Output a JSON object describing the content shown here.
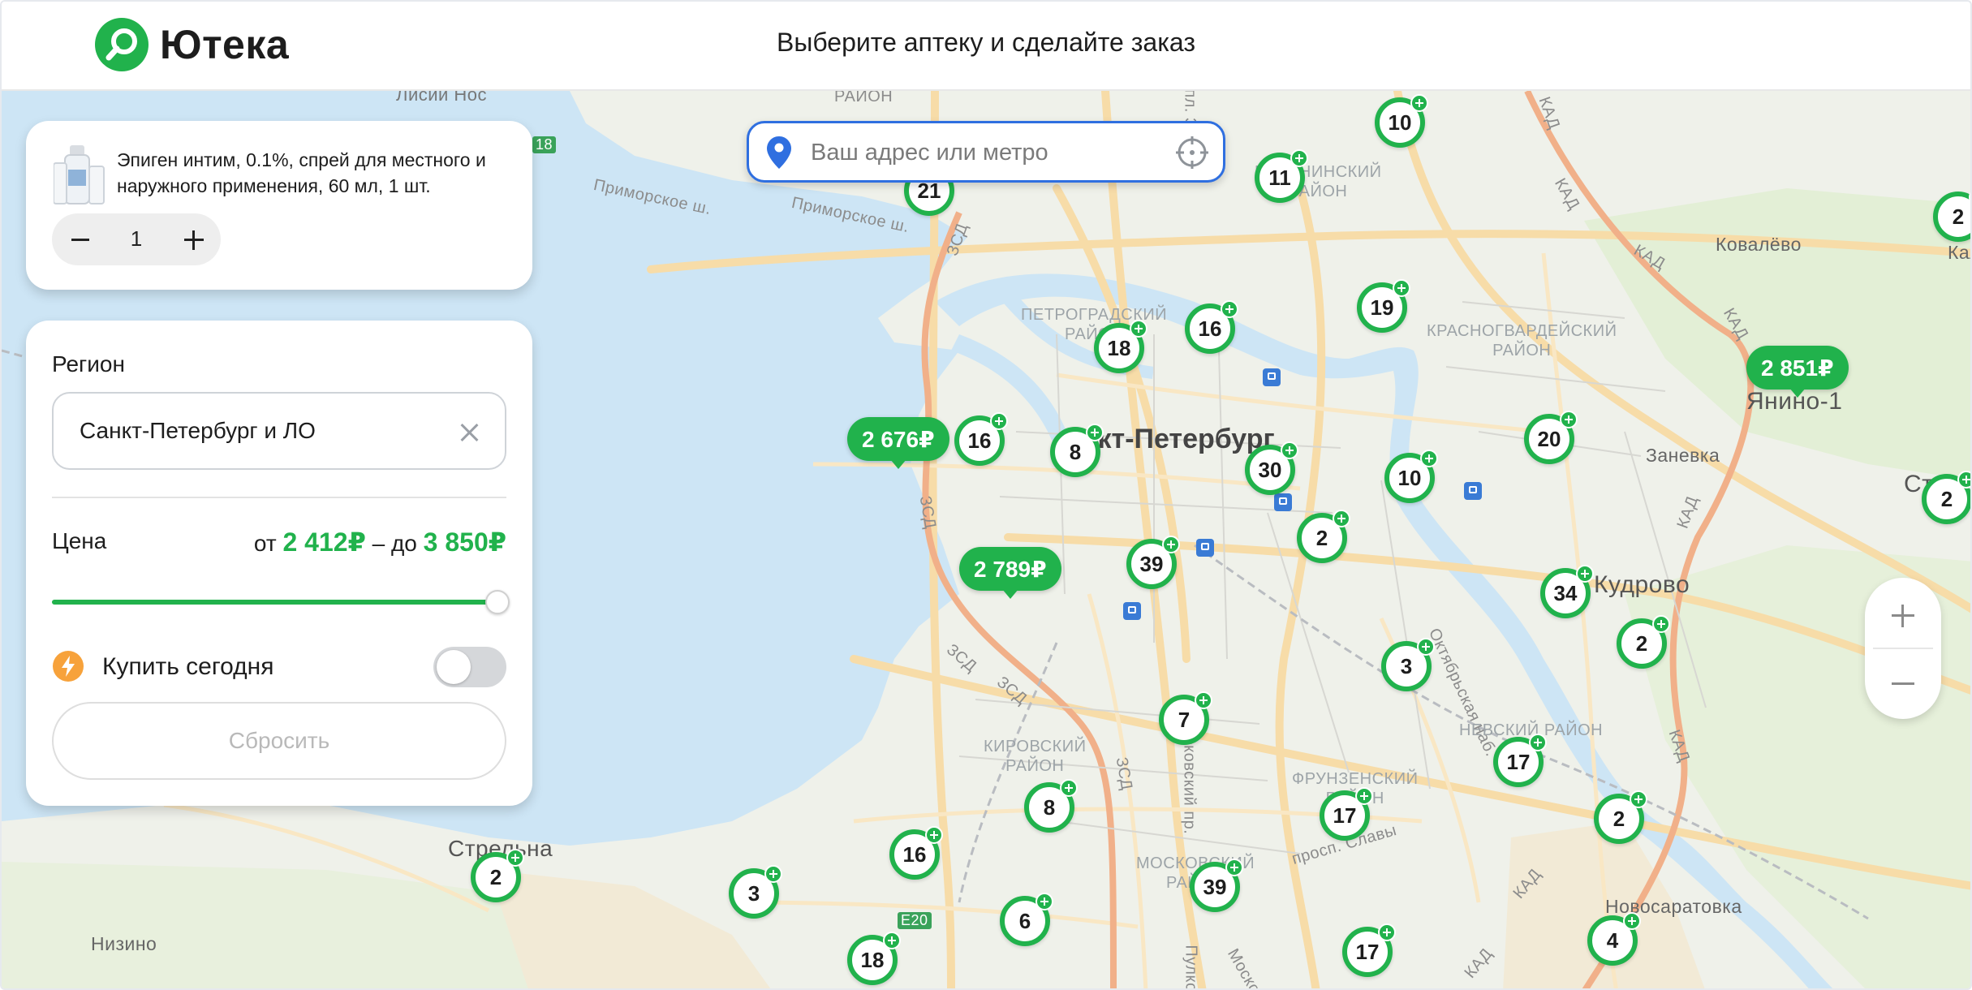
{
  "header": {
    "logo_text": "Ютека",
    "title": "Выберите аптеку и сделайте заказ"
  },
  "search": {
    "placeholder": "Ваш адрес или метро",
    "value": ""
  },
  "product": {
    "name": "Эпиген интим, 0.1%, спрей для местного и наружного применения, 60 мл, 1 шт.",
    "quantity": "1"
  },
  "filters": {
    "region_label": "Регион",
    "region_value": "Санкт-Петербург и ЛО",
    "price_label": "Цена",
    "price_from_prefix": "от",
    "price_from": "2 412₽",
    "price_separator": "– до",
    "price_to": "3 850₽",
    "price_slider_fraction": 0.98,
    "buy_today_label": "Купить сегодня",
    "buy_today_enabled": false,
    "reset_label": "Сбросить"
  },
  "colors": {
    "brand_green": "#21b24c",
    "search_border": "#2f6fe0",
    "bolt_orange": "#f7a23b"
  },
  "map": {
    "markers": [
      "21",
      "10",
      "11",
      "19",
      "16",
      "18",
      "16",
      "8",
      "30",
      "10",
      "20",
      "2",
      "39",
      "34",
      "2",
      "3",
      "7",
      "17",
      "8",
      "17",
      "2",
      "16",
      "39",
      "3",
      "2",
      "6",
      "18",
      "17",
      "4",
      "2",
      "2"
    ],
    "price_tags": [
      "2 676₽",
      "2 789₽",
      "2 851₽"
    ],
    "labels": {
      "city": "нкт-Петербург",
      "kudrovo": "Кудрово",
      "yanino": "Янино-1",
      "strelna": "Стрельна",
      "nizino": "Низино",
      "kovalevo": "Ковалёво",
      "zanevka": "Заневка",
      "novosaratovka": "Новосаратовка",
      "star": "Стар",
      "kal": "Кал",
      "lisiy_nos": "Лисий Нос",
      "raion_top": "РАЙОН",
      "kalininsky": "КАЛИНИНСКИЙ\nРАЙОН",
      "petrogradsky": "ПЕТРОГРАДСКИЙ\nРАЙОН",
      "krasnogvardeisky": "КРАСНОГВАРДЕЙСКИЙ\nРАЙОН",
      "nevsky": "НЕВСКИЙ РАЙОН",
      "frunzensky": "ФРУНЗЕНСКИЙ\nРАЙОН",
      "kirovsky": "КИРОВСКИЙ\nРАЙОН",
      "moskovsky": "МОСКОВСКИЙ\nРАЙОН",
      "primorskoe_sh1": "Приморское ш.",
      "primorskoe_sh2": "Приморское ш.",
      "zsd1": "ЗСД",
      "zsd2": "ЗСД",
      "zsd3": "ЗСД",
      "zsd4": "ЗСД",
      "zsd5": "ЗСД",
      "kad1": "КАД",
      "kad2": "КАД",
      "kad3": "КАД",
      "kad4": "КАД",
      "kad5": "КАД",
      "kad6": "КАД",
      "kad7": "КАД",
      "kad8": "КАД",
      "oktyabrskaya": "Октябрьская наб.",
      "moskovsky_pr": "Московский пр.",
      "slavy": "просп. Славы",
      "pulkovo": "Пулко",
      "moskov2": "Моско",
      "e20": "E20",
      "r18": "18",
      "pl": "пл. З"
    }
  }
}
